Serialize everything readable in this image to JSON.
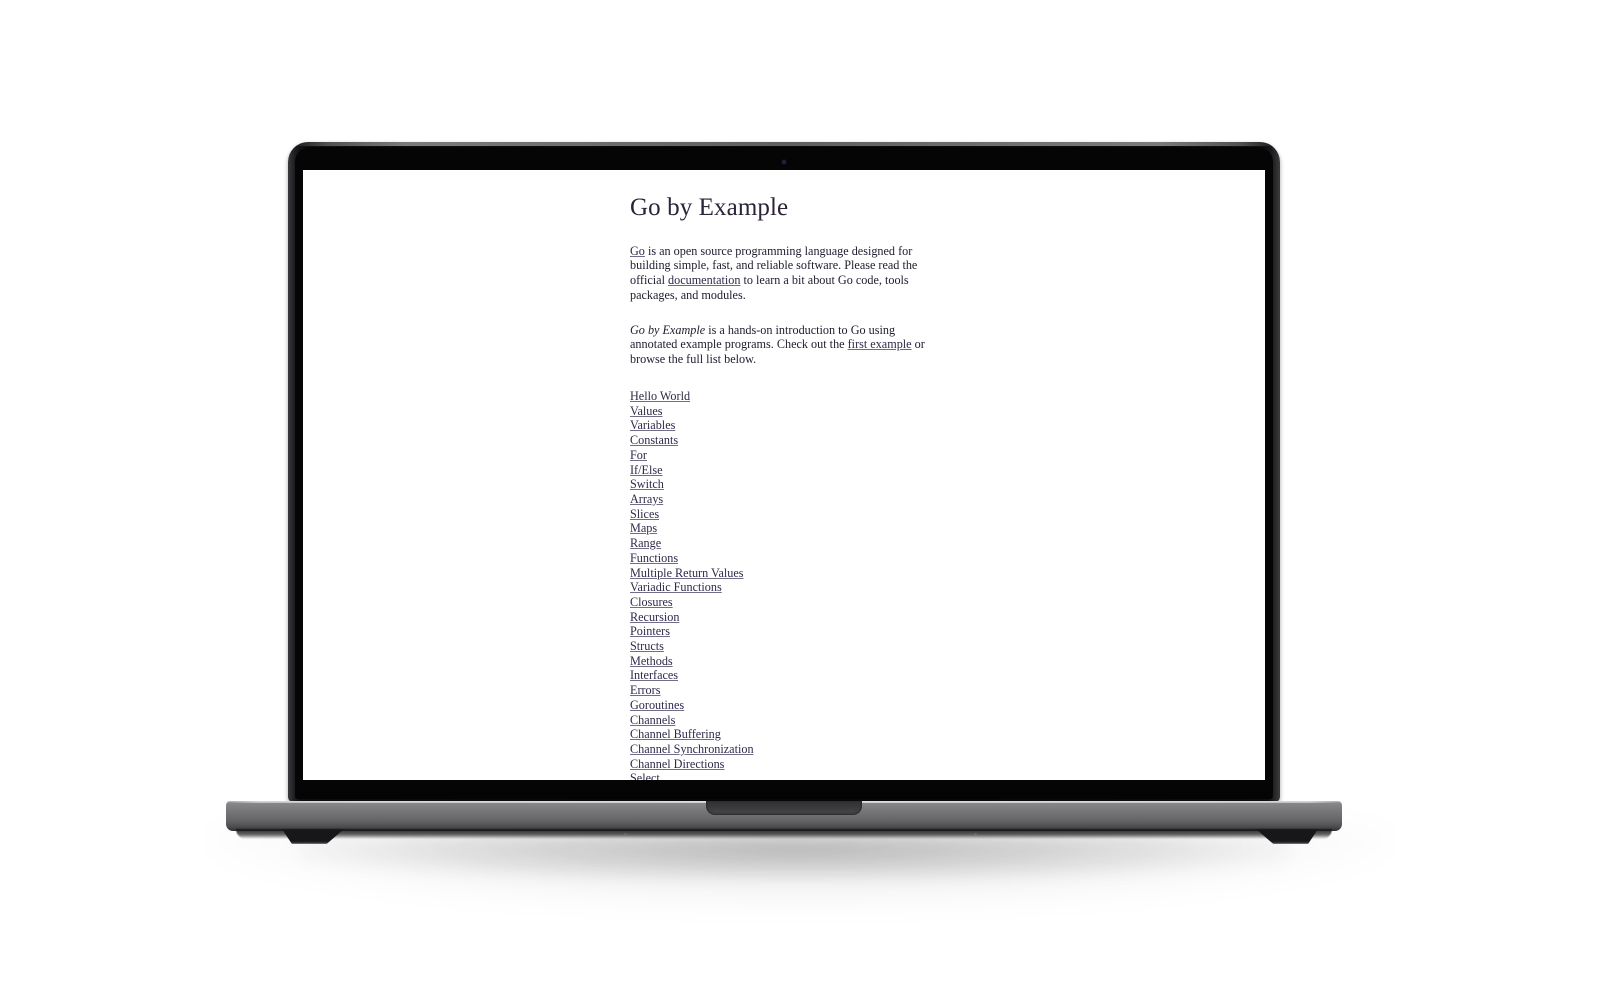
{
  "device": {
    "kind": "laptop-mockup",
    "camera_icon": "camera-dot-icon",
    "colors": {
      "page_background": "#ffffff",
      "screen_background": "#ffffff",
      "bezel": "#050506",
      "lid_edge": "#3a3a3c",
      "base_top": "#8d8d8f",
      "base_bottom": "#2e2e31",
      "text": "#1f1c2e",
      "heading": "#2b2438",
      "link": "#2e2a4a"
    }
  },
  "page": {
    "title": "Go by Example",
    "intro": {
      "before_go_link": "",
      "go_link": "Go",
      "after_go_link": " is an open source programming language designed for building simple, fast, and reliable software. Please read the official ",
      "documentation_link": "documentation",
      "tail": " to learn a bit about Go code, tools packages, and modules."
    },
    "description": {
      "emphasis": "Go by Example",
      "middle": " is a hands-on introduction to Go using annotated example programs. Check out the ",
      "first_example_link": "first example",
      "tail": " or browse the full list below."
    },
    "toc": [
      "Hello World",
      "Values",
      "Variables",
      "Constants",
      "For",
      "If/Else",
      "Switch",
      "Arrays",
      "Slices",
      "Maps",
      "Range",
      "Functions",
      "Multiple Return Values",
      "Variadic Functions",
      "Closures",
      "Recursion",
      "Pointers",
      "Structs",
      "Methods",
      "Interfaces",
      "Errors",
      "Goroutines",
      "Channels",
      "Channel Buffering",
      "Channel Synchronization",
      "Channel Directions",
      "Select"
    ]
  }
}
